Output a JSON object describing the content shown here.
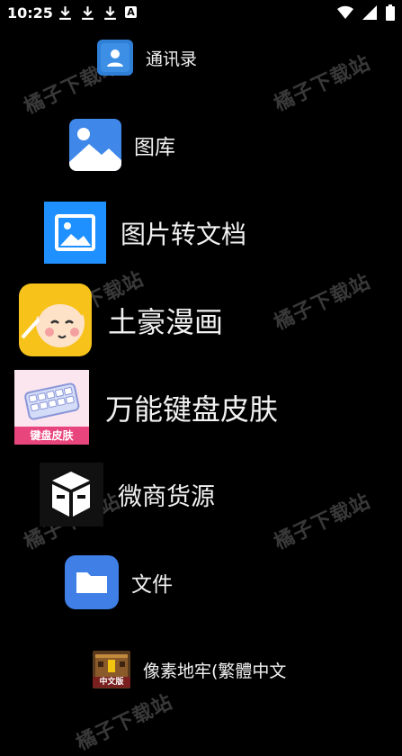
{
  "status": {
    "time": "10:25",
    "download_icons": [
      "download-icon",
      "download-icon",
      "download-icon"
    ],
    "a_badge": "A"
  },
  "watermark": "橘子下载站",
  "apps": [
    {
      "label": "通讯录",
      "icon": "contacts-icon"
    },
    {
      "label": "图库",
      "icon": "gallery-icon"
    },
    {
      "label": "图片转文档",
      "icon": "image-to-doc-icon"
    },
    {
      "label": "土豪漫画",
      "icon": "manga-app-icon"
    },
    {
      "label": "万能键盘皮肤",
      "icon": "keyboard-skin-icon",
      "icon_text": "键盘皮肤"
    },
    {
      "label": "微商货源",
      "icon": "wechat-goods-icon"
    },
    {
      "label": "文件",
      "icon": "files-folder-icon"
    },
    {
      "label": "像素地牢(繁體中文",
      "icon": "pixel-dungeon-icon",
      "icon_text": "中文版"
    }
  ],
  "colors": {
    "background": "#000000",
    "contacts_blue": "#2f7fd6",
    "gallery_blue": "#3f88ea",
    "doc_blue": "#1e90ff",
    "manga_yellow": "#f7c21a",
    "keyboard_pink": "#e8457c",
    "files_blue": "#3f7fe6"
  }
}
